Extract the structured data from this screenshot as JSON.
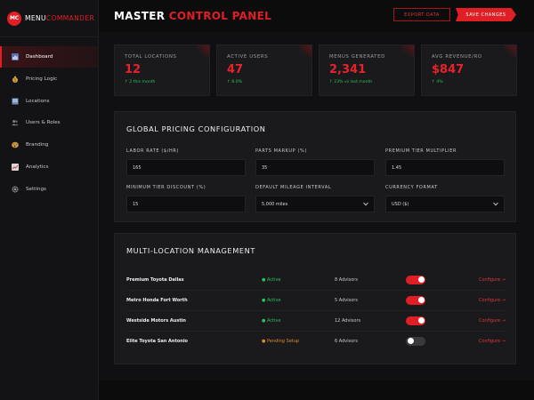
{
  "app": {
    "logo_badge": "MC",
    "logo_word_1": "MENU",
    "logo_word_2": "COMMANDER"
  },
  "sidebar": {
    "items": [
      {
        "label": "Dashboard",
        "icon": "bar-chart-icon",
        "active": true
      },
      {
        "label": "Pricing Logic",
        "icon": "money-bag-icon",
        "active": false
      },
      {
        "label": "Locations",
        "icon": "building-icon",
        "active": false
      },
      {
        "label": "Users & Roles",
        "icon": "users-icon",
        "active": false
      },
      {
        "label": "Branding",
        "icon": "palette-icon",
        "active": false
      },
      {
        "label": "Analytics",
        "icon": "line-chart-icon",
        "active": false
      },
      {
        "label": "Settings",
        "icon": "gear-icon",
        "active": false
      }
    ]
  },
  "header": {
    "title_part_1": "MASTER",
    "title_part_2": "CONTROL PANEL",
    "export_label": "EXPORT DATA",
    "save_label": "SAVE CHANGES"
  },
  "stats": [
    {
      "label": "TOTAL LOCATIONS",
      "value": "12",
      "change": "↑ 2 this month"
    },
    {
      "label": "ACTIVE USERS",
      "value": "47",
      "change": "↑ 8.0%"
    },
    {
      "label": "MENUS GENERATED",
      "value": "2,341",
      "change": "↑ 23% vs last month"
    },
    {
      "label": "AVG REVENUE/RO",
      "value": "$847",
      "change": "↑ 4%"
    }
  ],
  "pricing": {
    "title": "GLOBAL PRICING CONFIGURATION",
    "fields": [
      {
        "label": "LABOR RATE ($/HR)",
        "value": "165"
      },
      {
        "label": "PARTS MARKUP (%)",
        "value": "35"
      },
      {
        "label": "PREMIUM TIER MULTIPLIER",
        "value": "1.45"
      },
      {
        "label": "MINIMUM TIER DISCOUNT (%)",
        "value": "15"
      },
      {
        "label": "DEFAULT MILEAGE INTERVAL",
        "value": "5,000 miles"
      },
      {
        "label": "CURRENCY FORMAT",
        "value": "USD ($)"
      }
    ]
  },
  "locations": {
    "title": "MULTI-LOCATION MANAGEMENT",
    "rows": [
      {
        "name": "Premium Toyota Dallas",
        "status": "● Active",
        "advisors": "8 Advisors",
        "enabled": true,
        "action": "Configure →"
      },
      {
        "name": "Metro Honda Fort Worth",
        "status": "● Active",
        "advisors": "5 Advisors",
        "enabled": true,
        "action": "Configure →"
      },
      {
        "name": "Westside Motors Austin",
        "status": "● Active",
        "advisors": "12 Advisors",
        "enabled": true,
        "action": "Configure →"
      },
      {
        "name": "Elite Toyota San Antonio",
        "status": "● Pending Setup",
        "advisors": "6 Advisors",
        "enabled": false,
        "action": "Configure →"
      }
    ]
  },
  "colors": {
    "accent": "#e01e26",
    "active": "#27c25c",
    "pending": "#e08a2a"
  }
}
